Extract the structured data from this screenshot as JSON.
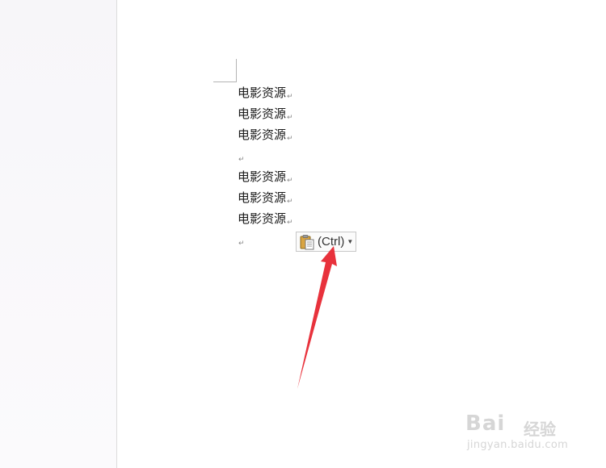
{
  "document": {
    "lines": [
      "电影资源",
      "电影资源",
      "电影资源",
      "",
      "电影资源",
      "电影资源",
      "电影资源",
      ""
    ],
    "paragraph_mark": "↵"
  },
  "paste_options": {
    "label": "(Ctrl)",
    "icon": "clipboard-paste-icon",
    "dropdown_icon": "caret-down-icon"
  },
  "annotation": {
    "arrow_color": "#e8323c"
  },
  "watermark": {
    "brand": "Bai",
    "sub": "经验",
    "url": "jingyan.baidu.com"
  }
}
